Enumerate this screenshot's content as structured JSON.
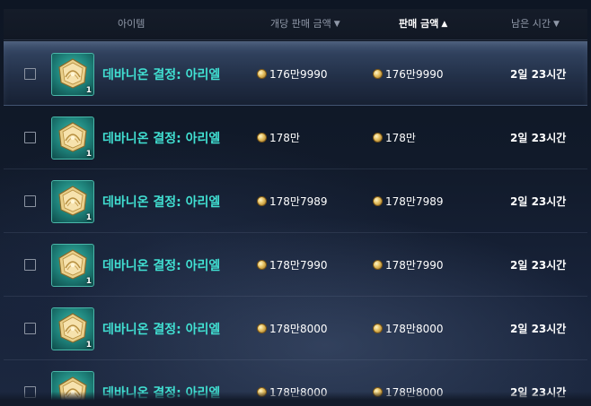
{
  "header": {
    "item_col": "아이템",
    "unit_price_col": "개당 판매 금액",
    "unit_price_arrow": "▼",
    "total_price_col": "판매 금액",
    "total_price_arrow": "▲",
    "time_col": "남은 시간",
    "time_arrow": "▼"
  },
  "rows": [
    {
      "name": "데바니온 결정: 아리엘",
      "qty": "1",
      "unit_price": "176만9990",
      "total_price": "176만9990",
      "time_left": "2일 23시간",
      "selected": true
    },
    {
      "name": "데바니온 결정: 아리엘",
      "qty": "1",
      "unit_price": "178만",
      "total_price": "178만",
      "time_left": "2일 23시간",
      "selected": false
    },
    {
      "name": "데바니온 결정: 아리엘",
      "qty": "1",
      "unit_price": "178만7989",
      "total_price": "178만7989",
      "time_left": "2일 23시간",
      "selected": false
    },
    {
      "name": "데바니온 결정: 아리엘",
      "qty": "1",
      "unit_price": "178만7990",
      "total_price": "178만7990",
      "time_left": "2일 23시간",
      "selected": false
    },
    {
      "name": "데바니온 결정: 아리엘",
      "qty": "1",
      "unit_price": "178만8000",
      "total_price": "178만8000",
      "time_left": "2일 23시간",
      "selected": false
    },
    {
      "name": "데바니온 결정: 아리엘",
      "qty": "1",
      "unit_price": "178만8000",
      "total_price": "178만8000",
      "time_left": "2일 23시간",
      "selected": false
    }
  ],
  "colors": {
    "item_name": "#41e0d2",
    "coin": "#e4be5e",
    "header_active": "#ffffff",
    "header_inactive": "#8f98a8"
  },
  "icons": {
    "item": "devanion-crystal-icon",
    "currency": "gold-coin-icon",
    "sort_desc": "triangle-down-icon",
    "sort_asc": "triangle-up-icon"
  }
}
